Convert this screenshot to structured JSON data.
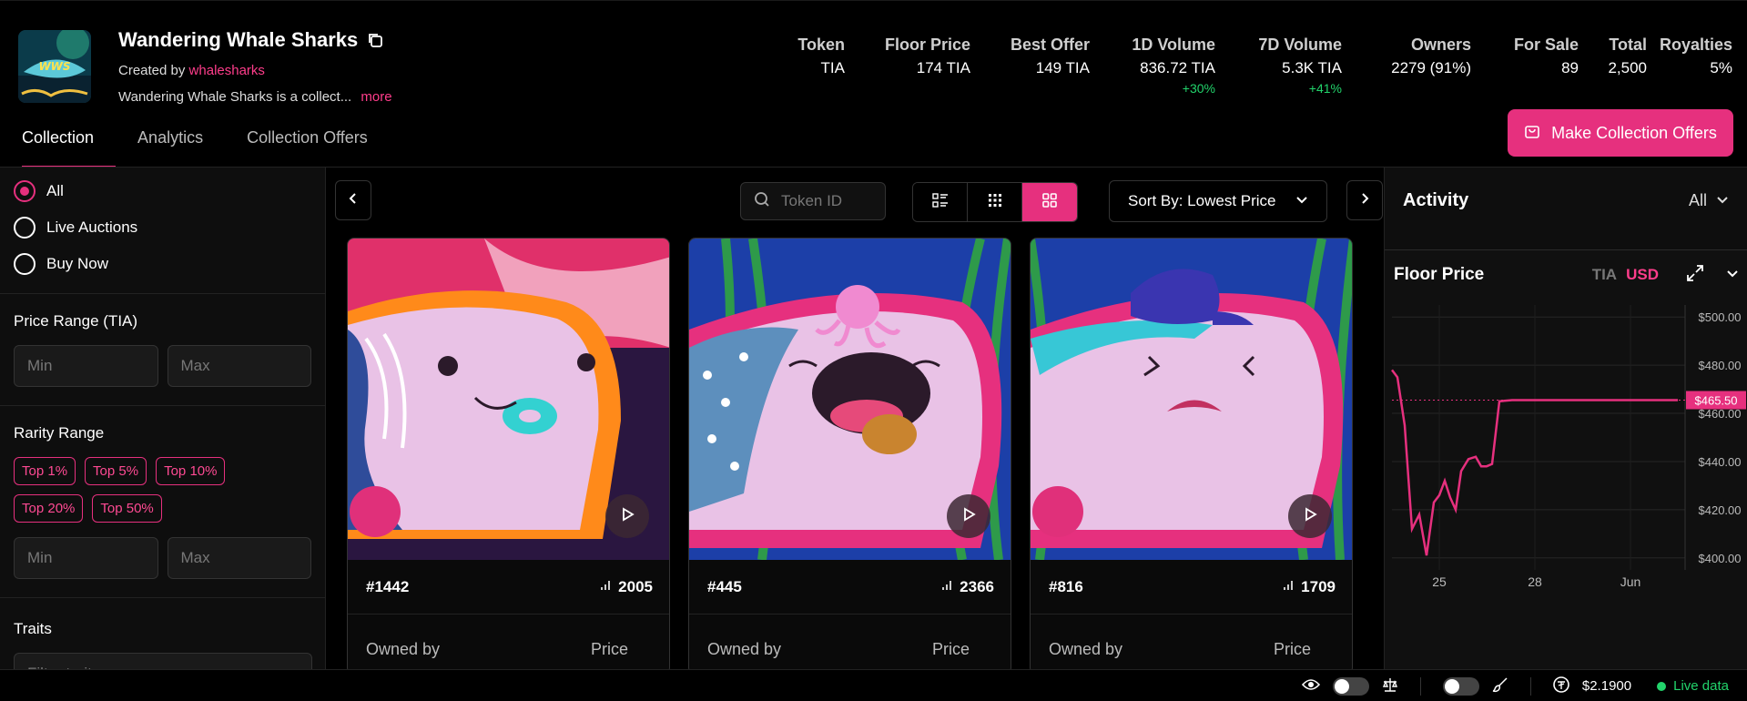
{
  "collection": {
    "name": "Wandering Whale Sharks",
    "created_by_label": "Created by",
    "creator": "whalesharks",
    "description": "Wandering Whale Sharks is a collect...",
    "more_label": "more"
  },
  "stats": [
    {
      "label": "Token",
      "value": "TIA",
      "change": ""
    },
    {
      "label": "Floor Price",
      "value": "174 TIA",
      "change": ""
    },
    {
      "label": "Best Offer",
      "value": "149 TIA",
      "change": ""
    },
    {
      "label": "1D Volume",
      "value": "836.72 TIA",
      "change": "+30%"
    },
    {
      "label": "7D Volume",
      "value": "5.3K TIA",
      "change": "+41%"
    },
    {
      "label": "Owners",
      "value": "2279 (91%)",
      "change": ""
    },
    {
      "label": "For Sale",
      "value": "89",
      "change": ""
    },
    {
      "label": "Total",
      "value": "2,500",
      "change": ""
    },
    {
      "label": "Royalties",
      "value": "5%",
      "change": ""
    }
  ],
  "tabs": [
    "Collection",
    "Analytics",
    "Collection Offers"
  ],
  "offer_button": "Make Collection Offers",
  "sidebar": {
    "radios": [
      "All",
      "Live Auctions",
      "Buy Now"
    ],
    "price_range_title": "Price Range (TIA)",
    "min_placeholder": "Min",
    "max_placeholder": "Max",
    "rarity_title": "Rarity Range",
    "rarity_chips": [
      "Top 1%",
      "Top 5%",
      "Top 10%",
      "Top 20%",
      "Top 50%"
    ],
    "traits_title": "Traits",
    "traits_placeholder": "Filter traits"
  },
  "toolbar": {
    "search_placeholder": "Token ID",
    "sort_label": "Sort By: Lowest Price"
  },
  "cards": [
    {
      "id": "#1442",
      "rank": "2005",
      "owned_label": "Owned by",
      "price_label": "Price"
    },
    {
      "id": "#445",
      "rank": "2366",
      "owned_label": "Owned by",
      "price_label": "Price"
    },
    {
      "id": "#816",
      "rank": "1709",
      "owned_label": "Owned by",
      "price_label": "Price"
    }
  ],
  "activity": {
    "title": "Activity",
    "filter": "All"
  },
  "floor_panel": {
    "title": "Floor Price",
    "currency_tia": "TIA",
    "currency_usd": "USD",
    "current_tag": "$465.50"
  },
  "chart_data": {
    "type": "line",
    "title": "Floor Price",
    "y_ticks": [
      "$500.00",
      "$480.00",
      "$460.00",
      "$440.00",
      "$420.00",
      "$400.00"
    ],
    "x_ticks": [
      "25",
      "28",
      "Jun"
    ],
    "ylim": [
      395,
      505
    ],
    "series": [
      {
        "color": "#e6307e",
        "values": [
          478,
          475,
          455,
          412,
          418,
          401,
          423,
          426,
          432,
          425,
          420,
          436,
          441,
          442,
          438,
          438,
          439,
          465,
          465.5,
          465.5,
          465.5,
          465.5,
          465.5,
          465.5,
          465.5,
          465.5
        ]
      }
    ],
    "current_value": 465.5
  },
  "footer": {
    "price": "$2.1900",
    "live_label": "Live data"
  },
  "colors": {
    "accent": "#e6307e",
    "positive": "#22d36b"
  }
}
